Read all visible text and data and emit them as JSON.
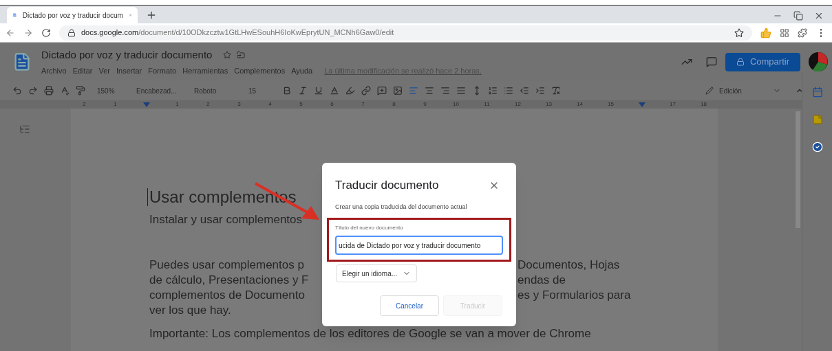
{
  "browser": {
    "tab": {
      "title": "Dictado por voz y traducir docum",
      "selected": true
    },
    "url": {
      "host": "docs.google.com",
      "path": "/document/d/10ODkzcztw1GtLHwESouhH6IoKwEprytUN_MCNh6Gaw0/edit"
    }
  },
  "docs": {
    "title": "Dictado por voz y traducir documento",
    "menu": [
      "Archivo",
      "Editar",
      "Ver",
      "Insertar",
      "Formato",
      "Herramientas",
      "Complementos",
      "Ayuda"
    ],
    "last_edit": "La última modificación se realizó hace 2 horas.",
    "share_button": "Compartir",
    "toolbar": {
      "zoom": "150%",
      "style": "Encabezad...",
      "font": "Roboto",
      "size": "15",
      "mode": "Edición",
      "align_buttons": [
        {
          "kind": "left",
          "selected": true
        },
        {
          "kind": "center",
          "selected": false
        },
        {
          "kind": "right",
          "selected": false
        },
        {
          "kind": "justify",
          "selected": false
        }
      ]
    },
    "ruler": [
      {
        "kind": "number",
        "label": "2"
      },
      {
        "kind": "number",
        "label": "1"
      },
      {
        "kind": "marker"
      },
      {
        "kind": "number",
        "label": "1"
      },
      {
        "kind": "number",
        "label": "2"
      },
      {
        "kind": "number",
        "label": "3"
      },
      {
        "kind": "number",
        "label": "4"
      },
      {
        "kind": "number",
        "label": "5"
      },
      {
        "kind": "number",
        "label": "6"
      },
      {
        "kind": "number",
        "label": "7"
      },
      {
        "kind": "number",
        "label": "8"
      },
      {
        "kind": "number",
        "label": "9"
      },
      {
        "kind": "number",
        "label": "10"
      },
      {
        "kind": "number",
        "label": "11"
      },
      {
        "kind": "number",
        "label": "12"
      },
      {
        "kind": "number",
        "label": "13"
      },
      {
        "kind": "number",
        "label": "14"
      },
      {
        "kind": "number",
        "label": "15"
      },
      {
        "kind": "marker"
      },
      {
        "kind": "number",
        "label": "17"
      },
      {
        "kind": "number",
        "label": "18"
      }
    ],
    "page": {
      "heading": "Usar complementos",
      "subheading": "Instalar y usar complementos",
      "paragraph_lines": [
        {
          "left": "Puedes usar complementos p",
          "right": "Documentos, Hojas"
        },
        {
          "left": "de cálculo, Presentaciones y F",
          "right": "endas de"
        },
        {
          "left": "complementos de Documento",
          "right": "es y Formularios para"
        },
        {
          "left": "ver los que hay."
        }
      ],
      "note": "Importante: Los complementos de los editores de Google se van a mover de Chrome"
    }
  },
  "dialog": {
    "title": "Traducir documento",
    "description": "Crear una copia traducida del documento actual",
    "field": {
      "label": "Título del nuevo documento",
      "value": "ucida de Dictado por voz y traducir documento"
    },
    "language_dropdown": "Elegir un idioma...",
    "buttons": [
      {
        "label": "Cancelar",
        "disabled": false
      },
      {
        "label": "Traducir",
        "disabled": true
      }
    ]
  }
}
